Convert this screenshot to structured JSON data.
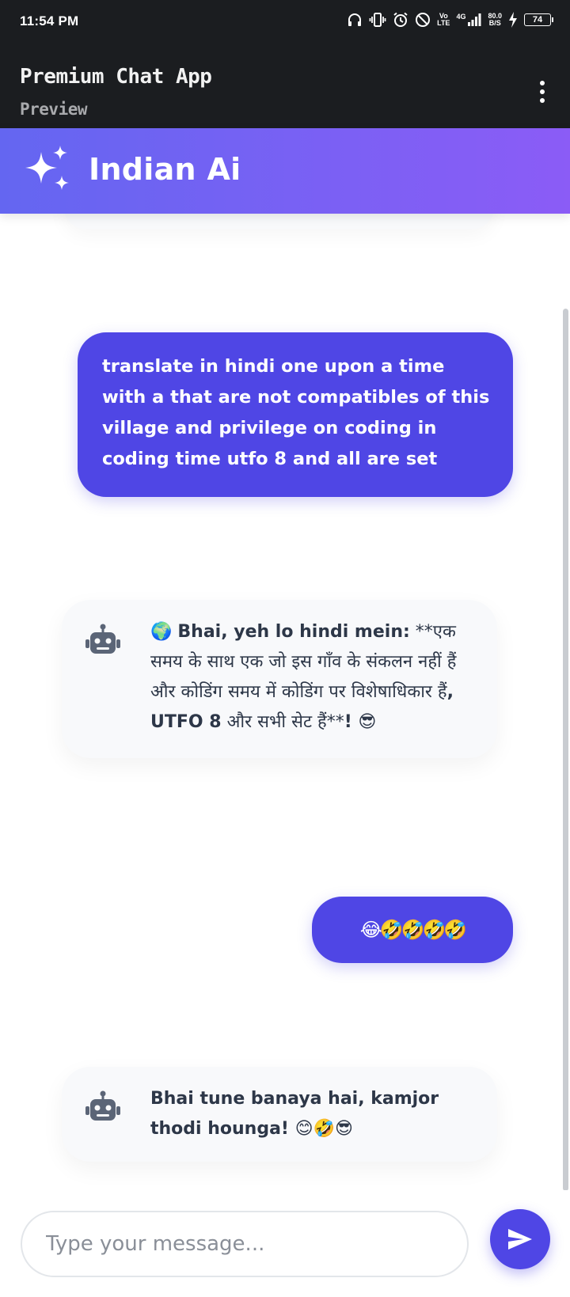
{
  "status_bar": {
    "time": "11:54 PM",
    "volte_top": "Vo",
    "volte_bottom": "LTE",
    "network": "4G",
    "speed_top": "80.0",
    "speed_bottom": "B/S",
    "battery": "74",
    "icons": [
      "headphones-icon",
      "vibrate-icon",
      "alarm-icon",
      "do-not-disturb-icon",
      "signal-icon",
      "charging-icon",
      "battery-icon"
    ]
  },
  "app_bar": {
    "title": "Premium Chat App",
    "subtitle": "Preview",
    "menu_icon": "more-vertical-icon"
  },
  "chat_header": {
    "title": "Indian Ai",
    "icon": "sparkles-icon",
    "colors": {
      "gradient_start": "#6466f1",
      "gradient_end": "#8b5cf6"
    }
  },
  "messages": [
    {
      "role": "user",
      "text": "translate in hindi one upon a time with a that are not compatibles of this village and privilege on coding in coding time utfo 8 and all are set"
    },
    {
      "role": "bot",
      "icon": "robot-icon",
      "parts": [
        "🌍 ",
        "Bhai, yeh lo hindi mein:",
        " **एक समय के साथ एक जो इस गाँव के संकलन नहीं हैं और कोडिंग समय में कोडिंग पर विशेषाधिकार हैं",
        ", UTFO 8",
        " और सभी सेट हैं**",
        "! 😎"
      ]
    },
    {
      "role": "user",
      "text": "😂🤣🤣🤣🤣"
    },
    {
      "role": "bot",
      "icon": "robot-icon",
      "text": "Bhai tune banaya hai, kamjor thodi hounga! 😊🤣😎"
    }
  ],
  "input": {
    "placeholder": "Type your message...",
    "value": "",
    "send_icon": "send-icon"
  },
  "colors": {
    "accent": "#4f46e5",
    "dark_bar": "#1b1d20",
    "bot_bubble": "#f8f9fb",
    "bot_text": "#2d3748"
  }
}
